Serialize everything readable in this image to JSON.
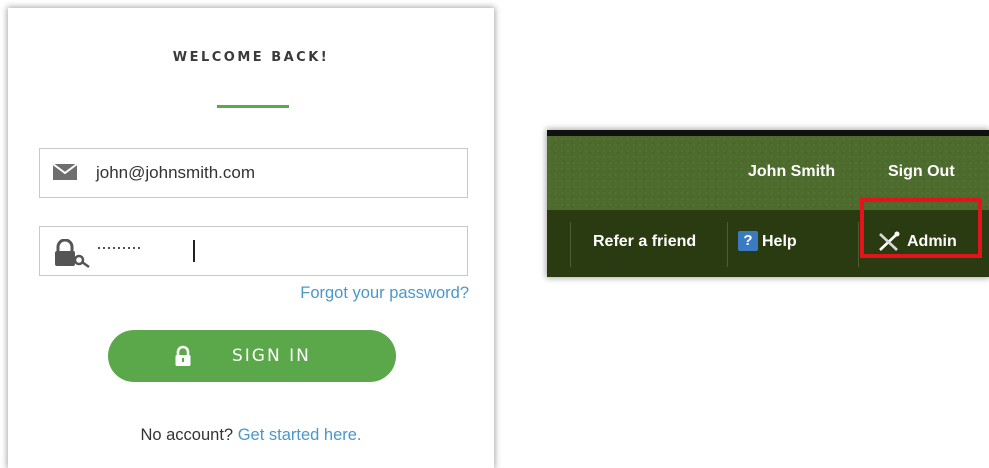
{
  "login": {
    "heading": "WELCOME BACK!",
    "email_value": "john@johnsmith.com",
    "password_mask": "·········",
    "forgot_link": "Forgot your password?",
    "signin_label": "SIGN IN",
    "no_account_text": "No account?",
    "get_started_link": "Get started here.",
    "accent_color": "#5aa84a",
    "link_color": "#4a98c8"
  },
  "header": {
    "user_name": "John Smith",
    "sign_out": "Sign Out",
    "refer": "Refer a friend",
    "help_icon_glyph": "?",
    "help": "Help",
    "admin": "Admin",
    "bar_color": "#4d6b2d",
    "nav_color": "#2b3b11",
    "highlight_color": "#e3141b"
  }
}
